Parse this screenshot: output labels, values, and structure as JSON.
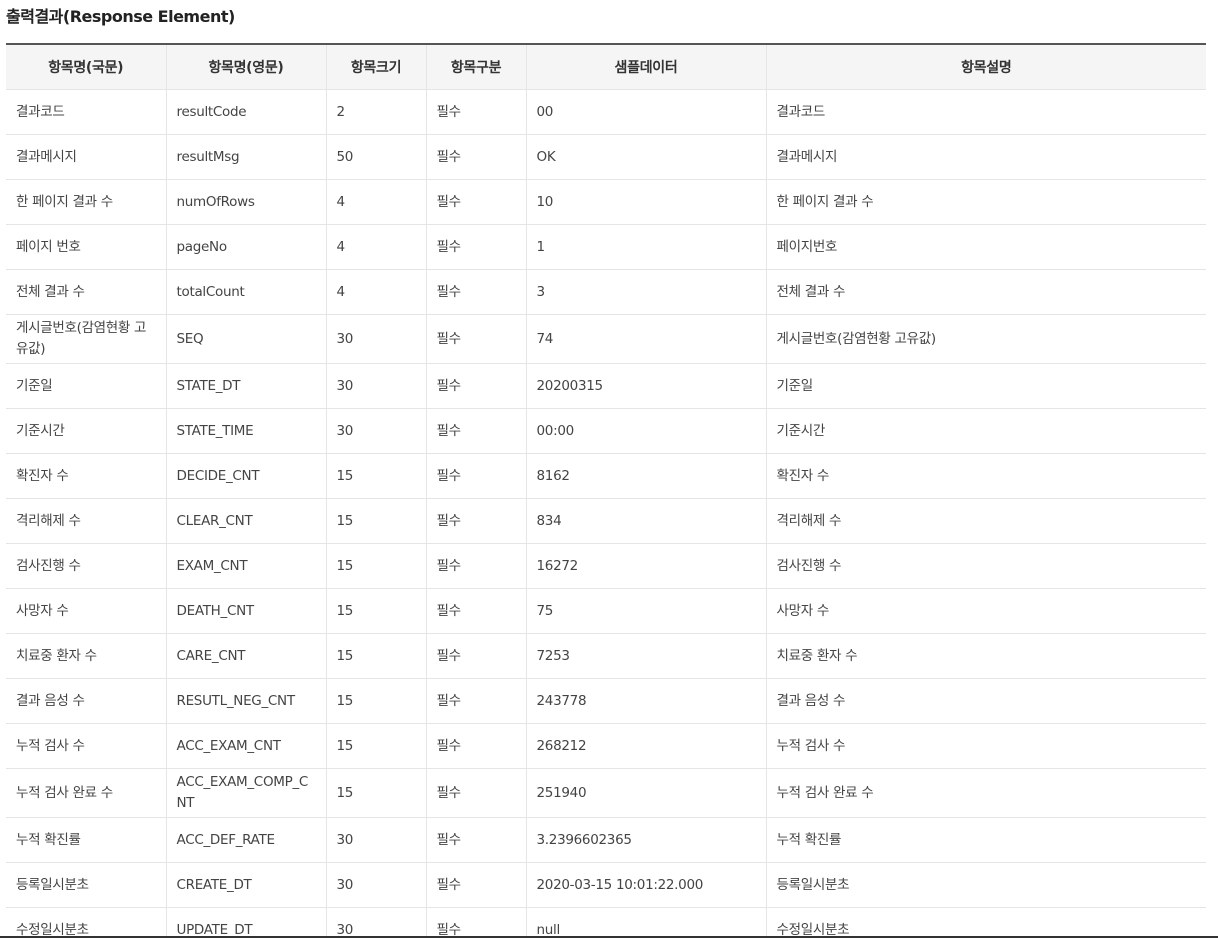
{
  "title": "출력결과(Response Element)",
  "columns": [
    "항목명(국문)",
    "항목명(영문)",
    "항목크기",
    "항목구분",
    "샘플데이터",
    "항목설명"
  ],
  "rows": [
    {
      "name_ko": "결과코드",
      "name_en": "resultCode",
      "size": "2",
      "type": "필수",
      "sample": "00",
      "desc": "결과코드"
    },
    {
      "name_ko": "결과메시지",
      "name_en": "resultMsg",
      "size": "50",
      "type": "필수",
      "sample": "OK",
      "desc": "결과메시지"
    },
    {
      "name_ko": "한 페이지 결과 수",
      "name_en": "numOfRows",
      "size": "4",
      "type": "필수",
      "sample": "10",
      "desc": "한 페이지 결과 수"
    },
    {
      "name_ko": "페이지 번호",
      "name_en": "pageNo",
      "size": "4",
      "type": "필수",
      "sample": "1",
      "desc": "페이지번호"
    },
    {
      "name_ko": "전체 결과 수",
      "name_en": "totalCount",
      "size": "4",
      "type": "필수",
      "sample": "3",
      "desc": "전체 결과 수"
    },
    {
      "name_ko": "게시글번호(감염현황 고유값)",
      "name_en": "SEQ",
      "size": "30",
      "type": "필수",
      "sample": "74",
      "desc": "게시글번호(감염현황 고유값)"
    },
    {
      "name_ko": "기준일",
      "name_en": "STATE_DT",
      "size": "30",
      "type": "필수",
      "sample": "20200315",
      "desc": "기준일"
    },
    {
      "name_ko": "기준시간",
      "name_en": "STATE_TIME",
      "size": "30",
      "type": "필수",
      "sample": "00:00",
      "desc": "기준시간"
    },
    {
      "name_ko": "확진자 수",
      "name_en": "DECIDE_CNT",
      "size": "15",
      "type": "필수",
      "sample": "8162",
      "desc": "확진자 수"
    },
    {
      "name_ko": "격리해제 수",
      "name_en": "CLEAR_CNT",
      "size": "15",
      "type": "필수",
      "sample": "834",
      "desc": "격리해제 수"
    },
    {
      "name_ko": "검사진행 수",
      "name_en": "EXAM_CNT",
      "size": "15",
      "type": "필수",
      "sample": "16272",
      "desc": "검사진행 수"
    },
    {
      "name_ko": "사망자 수",
      "name_en": "DEATH_CNT",
      "size": "15",
      "type": "필수",
      "sample": "75",
      "desc": "사망자 수"
    },
    {
      "name_ko": "치료중 환자 수",
      "name_en": "CARE_CNT",
      "size": "15",
      "type": "필수",
      "sample": "7253",
      "desc": "치료중 환자 수"
    },
    {
      "name_ko": "결과 음성 수",
      "name_en": "RESUTL_NEG_CNT",
      "size": "15",
      "type": "필수",
      "sample": "243778",
      "desc": "결과 음성 수"
    },
    {
      "name_ko": "누적 검사 수",
      "name_en": "ACC_EXAM_CNT",
      "size": "15",
      "type": "필수",
      "sample": "268212",
      "desc": "누적 검사 수"
    },
    {
      "name_ko": "누적 검사 완료 수",
      "name_en": "ACC_EXAM_COMP_CNT",
      "size": "15",
      "type": "필수",
      "sample": "251940",
      "desc": "누적 검사 완료 수"
    },
    {
      "name_ko": "누적 확진률",
      "name_en": "ACC_DEF_RATE",
      "size": "30",
      "type": "필수",
      "sample": "3.2396602365",
      "desc": "누적 확진률"
    },
    {
      "name_ko": "등록일시분초",
      "name_en": "CREATE_DT",
      "size": "30",
      "type": "필수",
      "sample": "2020-03-15 10:01:22.000",
      "desc": "등록일시분초"
    },
    {
      "name_ko": "수정일시분초",
      "name_en": "UPDATE_DT",
      "size": "30",
      "type": "필수",
      "sample": "null",
      "desc": "수정일시분초"
    }
  ]
}
